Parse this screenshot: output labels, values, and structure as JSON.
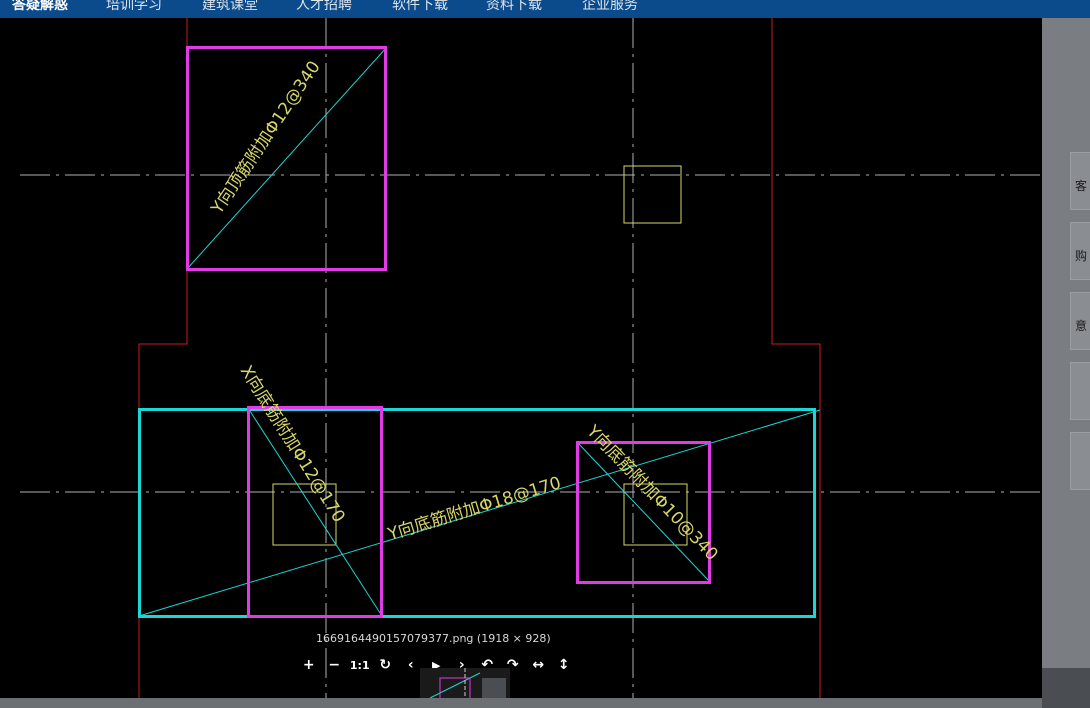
{
  "nav": {
    "items": [
      {
        "label": "答疑解惑",
        "active": true
      },
      {
        "label": "培训学习",
        "active": false
      },
      {
        "label": "建筑课堂",
        "active": false
      },
      {
        "label": "人才招聘",
        "active": false
      },
      {
        "label": "软件下载",
        "active": false
      },
      {
        "label": "资料下载",
        "active": false
      },
      {
        "label": "企业服务",
        "active": false
      }
    ]
  },
  "drawing": {
    "labels": {
      "top_left": "Y向顶筋附加Φ12@340",
      "mid_left": "X向底筋附加Φ12@170",
      "center": "Y向底筋附加Φ18@170",
      "right": "Y向底筋附加Φ10@340"
    },
    "colors": {
      "magenta": "#e03be6",
      "cyan": "#1ad6d6",
      "yellow": "#d6d66a",
      "red": "#c81e1e",
      "axis": "#cfcfcf"
    }
  },
  "viewer": {
    "file_caption": "1669164490157079377.png (1918 × 928)",
    "toolbar": {
      "zoom_in": "+",
      "zoom_out": "−",
      "actual_size": "1:1",
      "reset": "↻",
      "prev": "‹",
      "play": "▶",
      "next": "›",
      "rotate_left": "↶",
      "rotate_right": "↷",
      "flip_h": "↔",
      "flip_v": "↕"
    }
  },
  "side": {
    "buttons": [
      "客",
      "购",
      "意",
      "",
      ""
    ]
  }
}
